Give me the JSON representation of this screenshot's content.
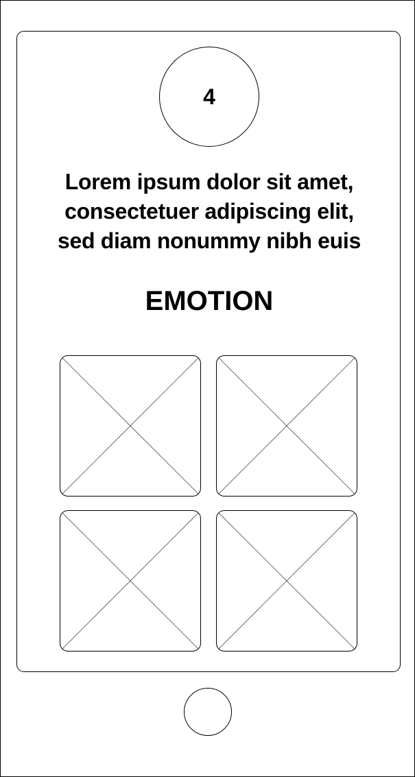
{
  "step": {
    "number": "4"
  },
  "prompt": {
    "lines": [
      "Lorem ipsum dolor sit amet,",
      "consectetuer adipiscing elit,",
      "sed diam nonummy nibh euis"
    ]
  },
  "heading": {
    "label": "EMOTION"
  },
  "options": [
    {
      "icon": "image-placeholder-icon"
    },
    {
      "icon": "image-placeholder-icon"
    },
    {
      "icon": "image-placeholder-icon"
    },
    {
      "icon": "image-placeholder-icon"
    }
  ],
  "colors": {
    "stroke": "#000000",
    "background": "#ffffff"
  }
}
